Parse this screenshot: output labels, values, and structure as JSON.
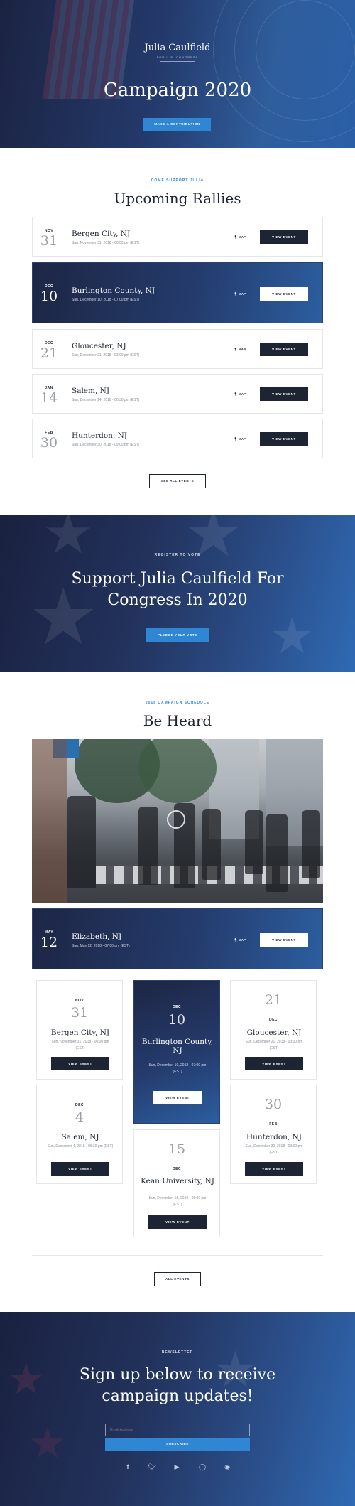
{
  "hero": {
    "name": "Julia Caulfield",
    "tagline": "FOR U.S. CONGRESS",
    "title": "Campaign 2020",
    "button": "MAKE A CONTRIBUTION"
  },
  "rallies": {
    "eyebrow": "COME SUPPORT JULIA",
    "title": "Upcoming Rallies",
    "events": [
      {
        "month": "NOV",
        "day": "31",
        "title": "Bergen City, NJ",
        "meta": "Sun, November 31, 2018 - 06:00 pm (EST)",
        "map": "MAP",
        "button": "VIEW EVENT"
      },
      {
        "month": "DEC",
        "day": "10",
        "title": "Burlington County, NJ",
        "meta": "Sun, December 10, 2018 - 07:00 pm (EST)",
        "map": "MAP",
        "button": "VIEW EVENT"
      },
      {
        "month": "DEC",
        "day": "21",
        "title": "Gloucester, NJ",
        "meta": "Sun, December 21, 2018 - 03:00 pm (EST)",
        "map": "MAP",
        "button": "VIEW EVENT"
      },
      {
        "month": "JAN",
        "day": "14",
        "title": "Salem, NJ",
        "meta": "Sun, December 14, 2018 - 06:30 pm (EST)",
        "map": "MAP",
        "button": "VIEW EVENT"
      },
      {
        "month": "FEB",
        "day": "30",
        "title": "Hunterdon, NJ",
        "meta": "Sun, December 30, 2018 - 09:00 pm (EST)",
        "map": "MAP",
        "button": "VIEW EVENT"
      }
    ],
    "see_all": "SEE ALL EVENTS"
  },
  "vote": {
    "eyebrow": "REGISTER TO VOTE",
    "title_line1": "Support Julia Caulfield For",
    "title_line2": "Congress In 2020",
    "button": "PLEDGE YOUR VOTE"
  },
  "schedule": {
    "eyebrow": "2018 CAMPAIGN SCHEDULE",
    "title": "Be Heard",
    "featured": {
      "month": "MAY",
      "day": "12",
      "title": "Elizabeth, NJ",
      "meta": "Sun, May 12, 2018 - 07:00 pm (EST)",
      "map": "MAP",
      "button": "VIEW EVENT"
    },
    "cards": [
      {
        "month": "NOV",
        "day": "31",
        "title": "Bergen City, NJ",
        "meta": "Sun, November 31, 2018 - 06:00 pm (EST)",
        "button": "VIEW EVENT"
      },
      {
        "month": "DEC",
        "day": "10",
        "title": "Burlington County, NJ",
        "meta": "Sun, December 10, 2018 - 07:00 pm (EST)",
        "button": "VIEW EVENT"
      },
      {
        "month": "DEC",
        "day": "21",
        "title": "Gloucester, NJ",
        "meta": "Sun, December 21, 2018 - 03:00 pm (EST)",
        "button": "VIEW EVENT"
      },
      {
        "month": "DEC",
        "day": "4",
        "title": "Salem, NJ",
        "meta": "Sun, December 4, 2018 - 06:30 pm (EST)",
        "button": "VIEW EVENT"
      },
      {
        "month": "DEC",
        "day": "15",
        "title": "Kean University, NJ",
        "meta": "Sun, December 15, 2018 - 06:00 pm (EST)",
        "button": "VIEW EVENT"
      },
      {
        "month": "FEB",
        "day": "30",
        "title": "Hunterdon, NJ",
        "meta": "Sun, December 30, 2018 - 09:00 pm (EST)",
        "button": "VIEW EVENT"
      }
    ],
    "all_events": "ALL EVENTS"
  },
  "newsletter": {
    "eyebrow": "NEWSLETTER",
    "title_line1": "Sign up below to receive",
    "title_line2": "campaign updates!",
    "email_placeholder": "Email Address",
    "button": "SUBSCRIBE"
  },
  "social": [
    "facebook-icon",
    "twitter-icon",
    "youtube-icon",
    "instagram-icon",
    "reddit-icon"
  ],
  "colors": {
    "accent": "#2f87d4",
    "navy": "#1d2433",
    "banner_dark": "#1a2140",
    "banner_light": "#2f6ab4"
  }
}
